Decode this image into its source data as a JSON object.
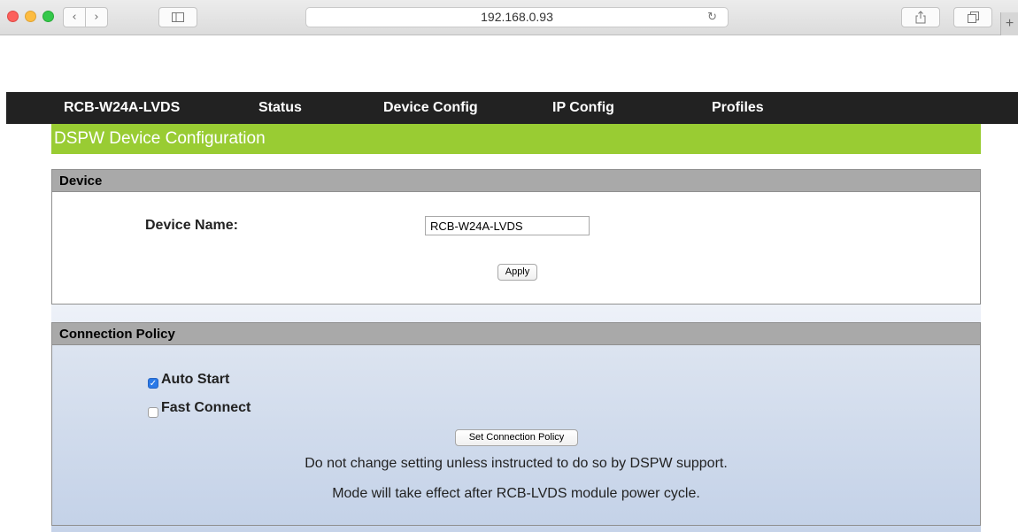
{
  "browser": {
    "address": "192.168.0.93",
    "icons": {
      "back": "chevron-left-icon",
      "forward": "chevron-right-icon",
      "sidebar": "sidebar-icon",
      "reload": "reload-icon",
      "share": "share-icon",
      "tabs": "tabs-icon",
      "new_tab": "plus-icon"
    }
  },
  "nav": {
    "items": [
      {
        "label": "RCB-W24A-LVDS"
      },
      {
        "label": "Status"
      },
      {
        "label": "Device Config"
      },
      {
        "label": "IP Config"
      },
      {
        "label": "Profiles"
      }
    ]
  },
  "page": {
    "title": "DSPW Device Configuration",
    "accent_color": "#99cc33"
  },
  "device": {
    "heading": "Device",
    "name_label": "Device Name:",
    "name_value": "RCB-W24A-LVDS",
    "apply_label": "Apply"
  },
  "connection": {
    "heading": "Connection Policy",
    "auto_start_label": "Auto Start",
    "auto_start_checked": true,
    "fast_connect_label": "Fast Connect",
    "fast_connect_checked": false,
    "button_label": "Set Connection Policy",
    "note1": "Do not change setting unless instructed to do so by DSPW support.",
    "note2": "Mode will take effect after RCB-LVDS module power cycle."
  }
}
